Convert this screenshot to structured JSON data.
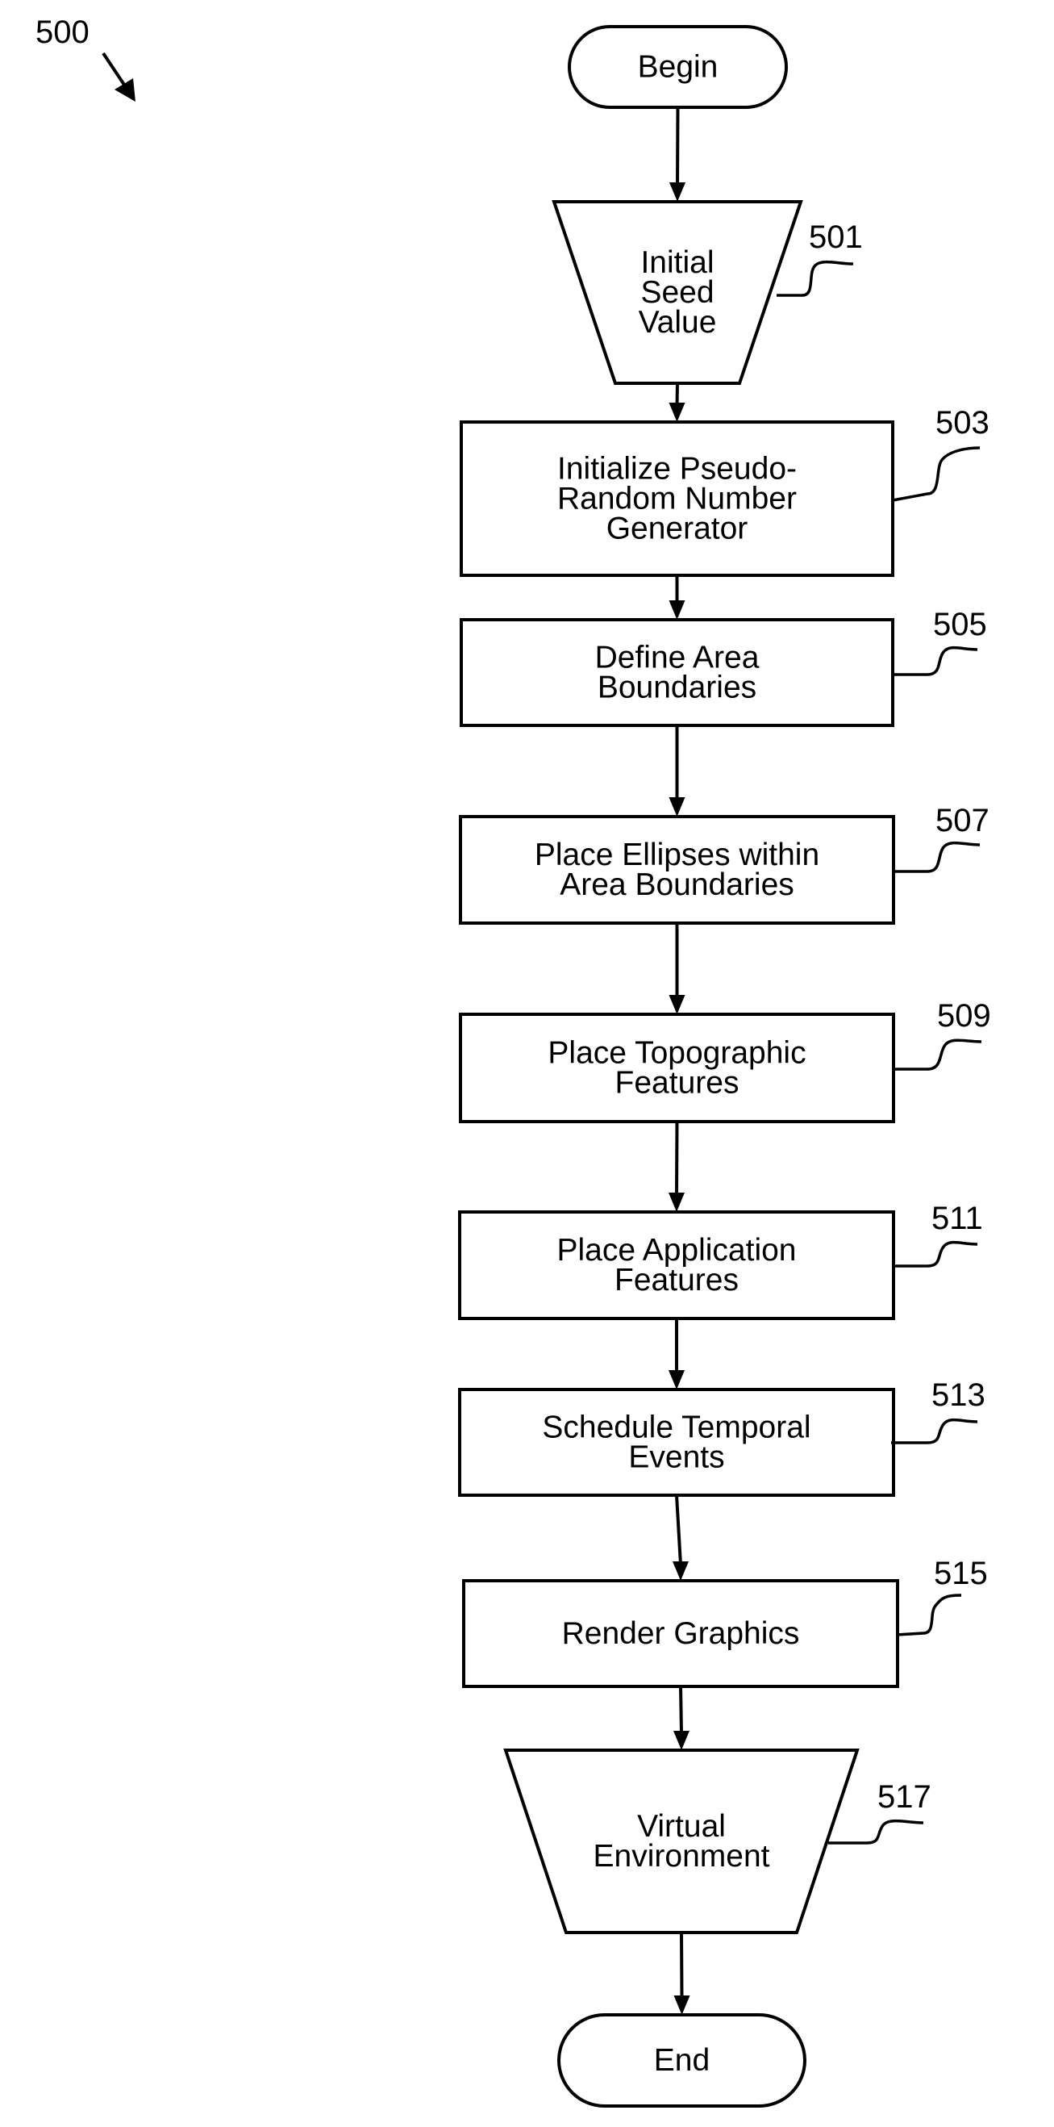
{
  "figure": {
    "reference": "500",
    "colors": {
      "ink": "#000000",
      "background": "#ffffff"
    }
  },
  "nodes": [
    {
      "id": "begin",
      "type": "terminator",
      "lines": [
        "Begin"
      ],
      "ref": ""
    },
    {
      "id": "initial-seed-value",
      "type": "manual-input",
      "lines": [
        "Initial",
        "Seed",
        "Value"
      ],
      "ref": "501"
    },
    {
      "id": "initialize-prng",
      "type": "process",
      "lines": [
        "Initialize Pseudo-",
        "Random Number",
        "Generator"
      ],
      "ref": "503"
    },
    {
      "id": "define-area-boundaries",
      "type": "process",
      "lines": [
        "Define Area",
        "Boundaries"
      ],
      "ref": "505"
    },
    {
      "id": "place-ellipses",
      "type": "process",
      "lines": [
        "Place Ellipses within",
        "Area Boundaries"
      ],
      "ref": "507"
    },
    {
      "id": "place-topographic-features",
      "type": "process",
      "lines": [
        "Place Topographic",
        "Features"
      ],
      "ref": "509"
    },
    {
      "id": "place-application-features",
      "type": "process",
      "lines": [
        "Place Application",
        "Features"
      ],
      "ref": "511"
    },
    {
      "id": "schedule-temporal-events",
      "type": "process",
      "lines": [
        "Schedule Temporal",
        "Events"
      ],
      "ref": "513"
    },
    {
      "id": "render-graphics",
      "type": "process",
      "lines": [
        "Render Graphics"
      ],
      "ref": "515"
    },
    {
      "id": "virtual-environment",
      "type": "manual-input",
      "lines": [
        "Virtual",
        "Environment"
      ],
      "ref": "517"
    },
    {
      "id": "end",
      "type": "terminator",
      "lines": [
        "End"
      ],
      "ref": ""
    }
  ],
  "edges": [
    {
      "from": "begin",
      "to": "initial-seed-value"
    },
    {
      "from": "initial-seed-value",
      "to": "initialize-prng"
    },
    {
      "from": "initialize-prng",
      "to": "define-area-boundaries"
    },
    {
      "from": "define-area-boundaries",
      "to": "place-ellipses"
    },
    {
      "from": "place-ellipses",
      "to": "place-topographic-features"
    },
    {
      "from": "place-topographic-features",
      "to": "place-application-features"
    },
    {
      "from": "place-application-features",
      "to": "schedule-temporal-events"
    },
    {
      "from": "schedule-temporal-events",
      "to": "render-graphics"
    },
    {
      "from": "render-graphics",
      "to": "virtual-environment"
    },
    {
      "from": "virtual-environment",
      "to": "end"
    }
  ]
}
